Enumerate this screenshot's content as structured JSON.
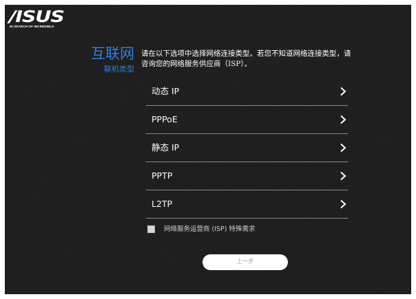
{
  "brand": {
    "name": "/ISUS",
    "tagline": "IN SEARCH OF INCREDIBLE"
  },
  "heading": {
    "title": "互联网",
    "subtitle": "联机类型"
  },
  "intro": {
    "text": "请在以下选项中选择网络连接类型。若您不知道网络连接类型，请咨询您的网络服务供应商（ISP）。"
  },
  "options": [
    {
      "label": "动态 IP",
      "icon": "chevron-right-icon"
    },
    {
      "label": "PPPoE",
      "icon": "chevron-right-icon"
    },
    {
      "label": "静态 IP",
      "icon": "chevron-right-icon"
    },
    {
      "label": "PPTP",
      "icon": "chevron-right-icon"
    },
    {
      "label": "L2TP",
      "icon": "chevron-right-icon"
    }
  ],
  "special_requirement": {
    "label": "网络服务运营商 (ISP) 特殊需求",
    "checked": false
  },
  "back_button": {
    "label": "上一步"
  },
  "colors": {
    "accent": "#2f7fe0",
    "background": "#1e1e1e",
    "divider": "#8c8c8c",
    "text": "#ffffff"
  }
}
